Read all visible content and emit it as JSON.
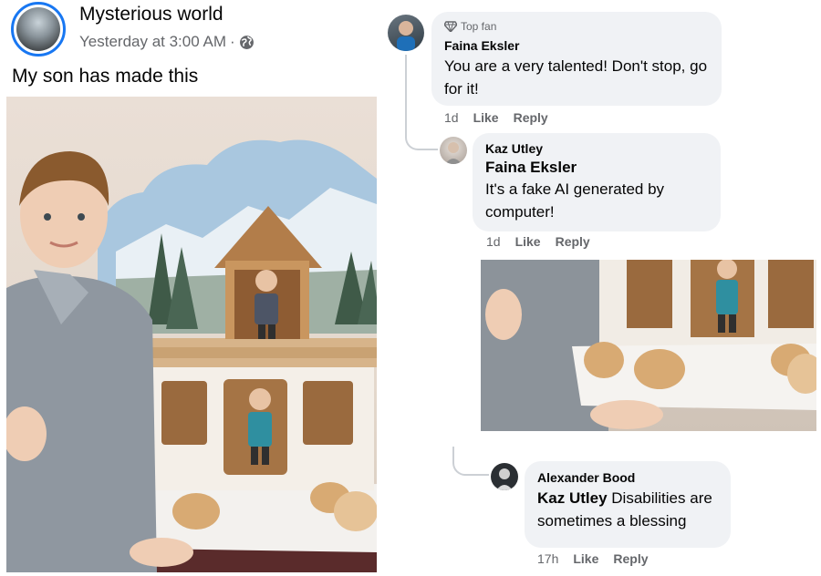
{
  "post": {
    "author": "Mysterious world",
    "timestamp": "Yesterday at 3:00 AM",
    "separator": "·",
    "privacy_icon": "globe-icon",
    "text": "My son has made this",
    "image_alt": "boy-with-wooden-toy-house-photo"
  },
  "comments": [
    {
      "badge": "Top fan",
      "badge_icon": "diamond-icon",
      "author": "Faina Eksler",
      "text": "You are a very talented! Don't stop, go for it!",
      "age": "1d",
      "like": "Like",
      "reply": "Reply"
    },
    {
      "author": "Kaz Utley",
      "mention": "Faina Eksler",
      "text": "It's a fake AI generated by computer!",
      "age": "1d",
      "like": "Like",
      "reply": "Reply",
      "image_alt": "closeup-wooden-house-photo"
    },
    {
      "author": "Alexander Bood",
      "mention": "Kaz Utley",
      "text": "Disabilities are sometimes a blessing",
      "age": "17h",
      "like": "Like",
      "reply": "Reply"
    }
  ],
  "colors": {
    "accent": "#1877f2",
    "bubble": "#f0f2f5",
    "muted": "#65676b"
  }
}
